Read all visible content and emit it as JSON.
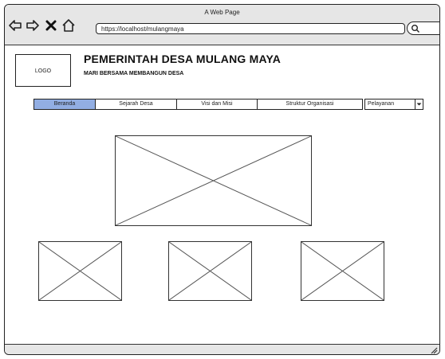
{
  "window": {
    "title": "A Web Page"
  },
  "browser": {
    "url": "https://localhost/mulangmaya",
    "nav_icons": [
      "back-arrow-icon",
      "forward-arrow-icon",
      "close-icon",
      "home-icon"
    ],
    "search_icon": "search-icon"
  },
  "header": {
    "logo_label": "LOGO",
    "title": "PEMERINTAH DESA MULANG MAYA",
    "subtitle": "MARI BERSAMA MEMBANGUN DESA"
  },
  "menu": {
    "items": [
      {
        "label": "Beranda",
        "active": true
      },
      {
        "label": "Sejarah Desa",
        "active": false
      },
      {
        "label": "Visi dan Misi",
        "active": false
      },
      {
        "label": "Struktur Organisasi",
        "active": false
      }
    ],
    "dropdown_value": "Pelayanan"
  },
  "colors": {
    "active_tab": "#92aee3",
    "chrome": "#e6e6e6"
  }
}
